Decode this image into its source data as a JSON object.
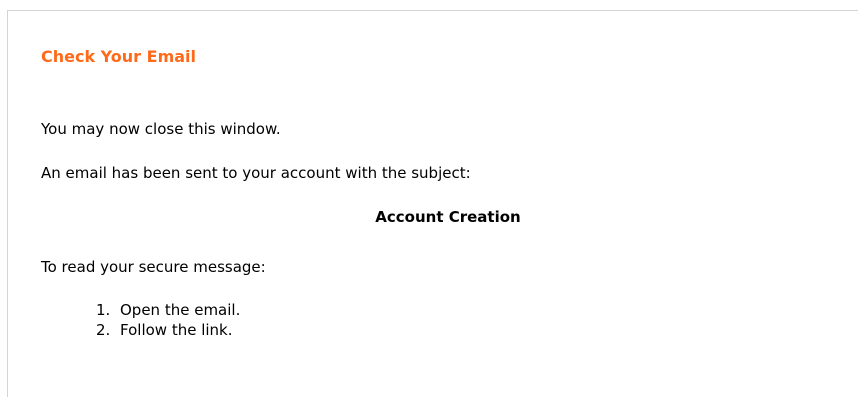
{
  "page": {
    "title": "Check Your Email",
    "close_message": "You may now close this window.",
    "sent_message": "An email has been sent to your account with the subject:",
    "subject": "Account Creation",
    "instructions_intro": "To read your secure message:",
    "steps": [
      {
        "number": "1.",
        "text": "Open the email."
      },
      {
        "number": "2.",
        "text": "Follow the link."
      }
    ]
  },
  "colors": {
    "title": "#ff6a1a",
    "border": "#d4d4d4"
  }
}
